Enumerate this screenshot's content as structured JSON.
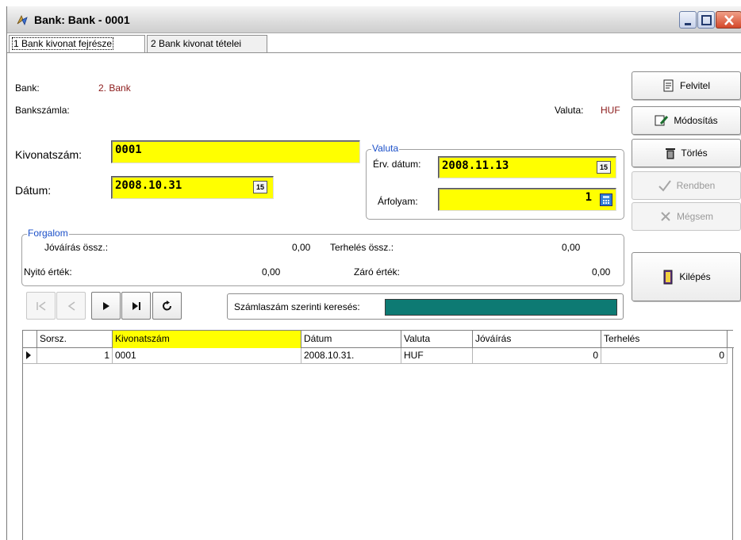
{
  "window": {
    "title": "Bank: Bank - 0001"
  },
  "tabs": [
    {
      "label": "1 Bank kivonat fejrésze",
      "active": true
    },
    {
      "label": "2 Bank kivonat tételei",
      "active": false
    }
  ],
  "header": {
    "bank_label": "Bank:",
    "bank_value": "2.   Bank",
    "account_label": "Bankszámla:",
    "currency_label": "Valuta:",
    "currency_value": "HUF"
  },
  "form": {
    "kivonatszam_label": "Kivonatszám:",
    "kivonatszam_value": "0001",
    "datum_label": "Dátum:",
    "datum_value": "2008.10.31",
    "calendar_icon_text": "15"
  },
  "valuta_group": {
    "title": "Valuta",
    "erv_datum_label": "Érv. dátum:",
    "erv_datum_value": "2008.11.13",
    "arfolyam_label": "Árfolyam:",
    "arfolyam_value": "1"
  },
  "forgalom": {
    "title": "Forgalom",
    "jovairas_label": "Jóváírás össz.:",
    "jovairas_value": "0,00",
    "terheles_label": "Terhelés össz.:",
    "terheles_value": "0,00",
    "nyito_label": "Nyitó érték:",
    "nyito_value": "0,00",
    "zaro_label": "Záró érték:",
    "zaro_value": "0,00"
  },
  "buttons": {
    "felvitel": "Felvitel",
    "modositas": "Módosítás",
    "torles": "Törlés",
    "rendben": "Rendben",
    "megsem": "Mégsem",
    "kilepes": "Kilépés"
  },
  "search": {
    "label": "Számlaszám szerinti keresés:"
  },
  "table": {
    "columns": [
      "Sorsz.",
      "Kivonatszám",
      "Dátum",
      "Valuta",
      "Jóváírás",
      "Terhelés"
    ],
    "rows": [
      [
        "1",
        "0001",
        "2008.10.31.",
        "HUF",
        "0",
        "0"
      ]
    ]
  },
  "colors": {
    "highlight": "#ffff00",
    "search_field": "#0d7a73",
    "group_title": "#1a4fc9",
    "value_red": "#8b1a1a"
  },
  "icons": [
    "bank-app-icon",
    "minimize-icon",
    "maximize-icon",
    "close-icon",
    "calendar-icon",
    "calculator-icon",
    "new-record-icon",
    "edit-icon",
    "trash-icon",
    "check-icon",
    "cancel-x-icon",
    "exit-door-icon",
    "first-record-icon",
    "prev-record-icon",
    "next-record-icon",
    "last-record-icon",
    "refresh-icon",
    "row-pointer-icon"
  ]
}
